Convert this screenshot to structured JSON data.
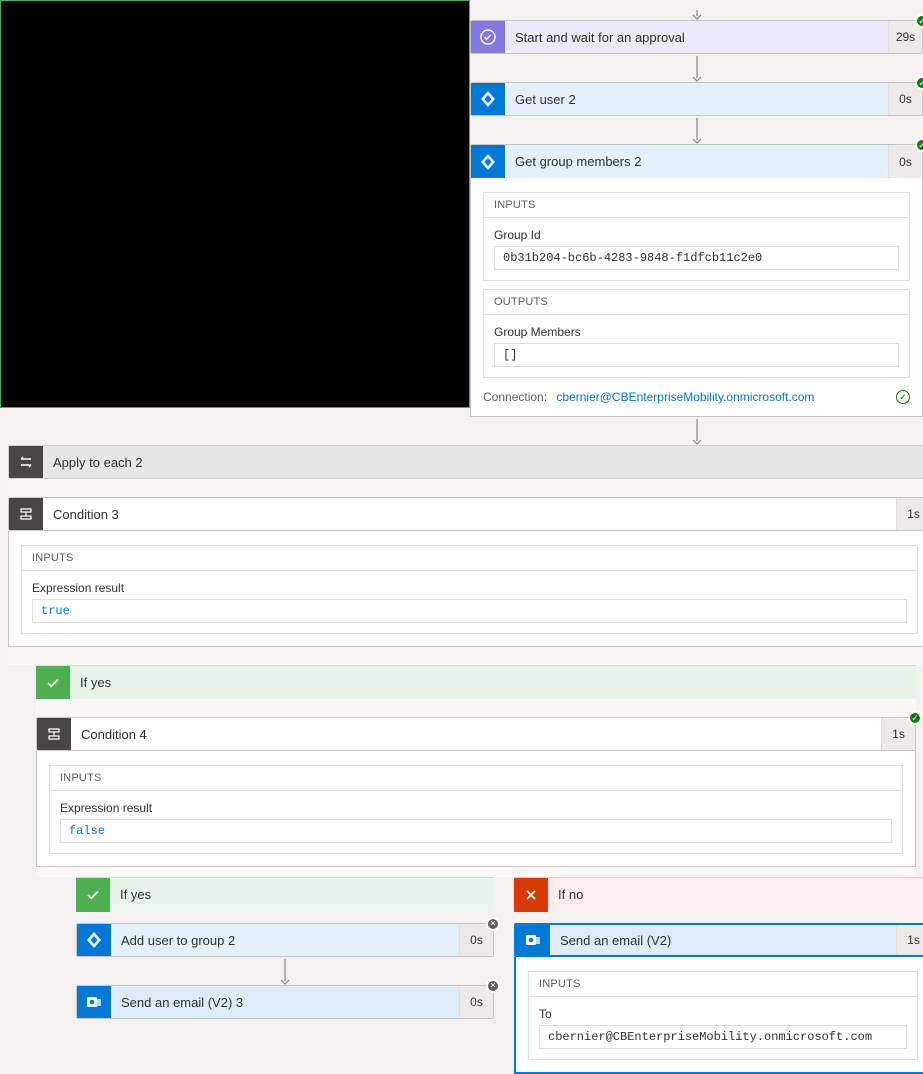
{
  "steps": {
    "approval": {
      "title": "Start and wait for an approval",
      "duration": "29s"
    },
    "getuser2": {
      "title": "Get user 2",
      "duration": "0s"
    },
    "getgroup2": {
      "title": "Get group members 2",
      "duration": "0s",
      "inputs_label": "INPUTS",
      "group_id_label": "Group Id",
      "group_id_value": "0b31b204-bc6b-4283-9848-f1dfcb11c2e0",
      "outputs_label": "OUTPUTS",
      "group_members_label": "Group Members",
      "group_members_value": "[]",
      "connection_label": "Connection:",
      "connection_value": "cbernier@CBEnterpriseMobility.onmicrosoft.com"
    },
    "applytoeach2": {
      "title": "Apply to each 2"
    },
    "condition3": {
      "title": "Condition 3",
      "duration": "1s",
      "inputs_label": "INPUTS",
      "expr_label": "Expression result",
      "expr_value": "true"
    },
    "ifyes1": {
      "title": "If yes"
    },
    "condition4": {
      "title": "Condition 4",
      "duration": "1s",
      "inputs_label": "INPUTS",
      "expr_label": "Expression result",
      "expr_value": "false"
    },
    "ifyes2": {
      "title": "If yes"
    },
    "ifno2": {
      "title": "If no"
    },
    "adduser": {
      "title": "Add user to group 2",
      "duration": "0s"
    },
    "sendemail3": {
      "title": "Send an email (V2) 3",
      "duration": "0s"
    },
    "sendemail": {
      "title": "Send an email (V2)",
      "duration": "1s",
      "inputs_label": "INPUTS",
      "to_label": "To",
      "to_value": "cbernier@CBEnterpriseMobility.onmicrosoft.com"
    }
  }
}
